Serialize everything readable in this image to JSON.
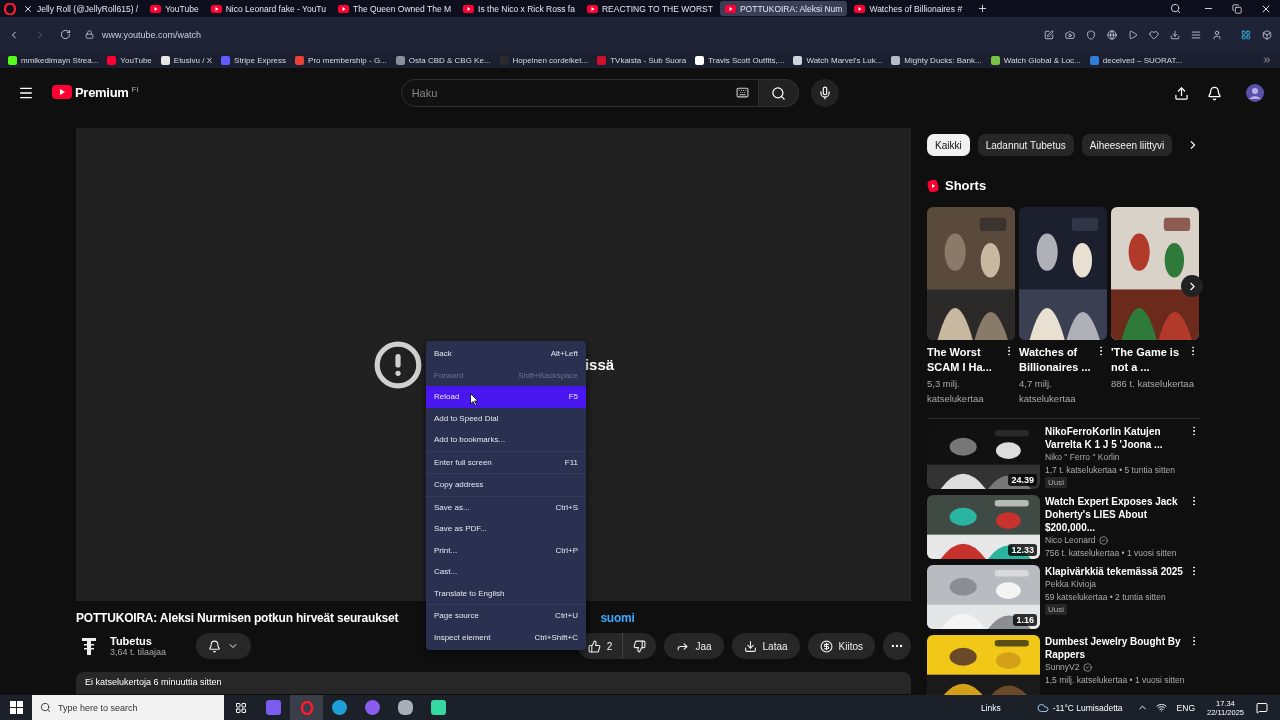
{
  "browser": {
    "tabs": [
      {
        "title": "Jelly Roll (@JellyRoll615) /",
        "kind": "x",
        "selected": false
      },
      {
        "title": "YouTube",
        "kind": "youtube",
        "selected": false
      },
      {
        "title": "Nico Leonard fake - YouTu",
        "kind": "youtube",
        "selected": false
      },
      {
        "title": "The Queen Owned The M",
        "kind": "youtube",
        "selected": false
      },
      {
        "title": "Is the Nico x Rick Ross fa",
        "kind": "youtube",
        "selected": false
      },
      {
        "title": "REACTING TO THE WORST",
        "kind": "youtube",
        "selected": false
      },
      {
        "title": "POTTUKOIRA: Aleksi Num",
        "kind": "youtube",
        "selected": true
      },
      {
        "title": "Watches of Billionaires #",
        "kind": "youtube",
        "selected": false
      }
    ],
    "address": "www.youtube.com/watch",
    "bookmarks": [
      {
        "label": "mmikedimayn Strea...",
        "color": "#53fc18"
      },
      {
        "label": "YouTube",
        "color": "#ff0033"
      },
      {
        "label": "Etusivu / X",
        "color": "#e6e6e6"
      },
      {
        "label": "Stripe Express",
        "color": "#635bff"
      },
      {
        "label": "Pro membership - G...",
        "color": "#ea4335"
      },
      {
        "label": "Osta CBD & CBG Ke...",
        "color": "#8a8f99"
      },
      {
        "label": "Hopeinen cordelket...",
        "color": "#2b2b2b"
      },
      {
        "label": "TVkaista - Sub Suora",
        "color": "#d0102a"
      },
      {
        "label": "Travis Scott Outfits,...",
        "color": "#ffffff"
      },
      {
        "label": "Watch Marvel's Luk...",
        "color": "#cfd3dc"
      },
      {
        "label": "Mighty Ducks: Bank...",
        "color": "#b8bcc6"
      },
      {
        "label": "Watch Global & Loc...",
        "color": "#7cc242"
      },
      {
        "label": "deceived – SUORAT...",
        "color": "#2f7fd6"
      }
    ]
  },
  "header": {
    "logo": "Premium",
    "region": "FI",
    "search": {
      "placeholder": "Haku"
    }
  },
  "player": {
    "error_text": "issä"
  },
  "video": {
    "title": "POTTUKOIRA: Aleksi Nurmisen potkun hirveät seuraukset",
    "hashtag": "suomi",
    "channel": "Tubetus",
    "subscribers": "3,64 t. tilaajaa",
    "likes": "2",
    "actions": [
      {
        "kind": "share",
        "label": "Jaa"
      },
      {
        "kind": "download",
        "label": "Lataa"
      },
      {
        "kind": "thanks",
        "label": "Kiitos"
      }
    ],
    "description": "Ei katselukertoja 6 minuuttia sitten"
  },
  "context_menu": {
    "groups": [
      [
        {
          "label": "Back",
          "shortcut": "Alt+Left",
          "disabled": false,
          "selected": false
        },
        {
          "label": "Forward",
          "shortcut": "Shift+Backspace",
          "disabled": true,
          "selected": false
        },
        {
          "label": "Reload",
          "shortcut": "F5",
          "disabled": false,
          "selected": true
        },
        {
          "label": "Add to Speed Dial",
          "disabled": false,
          "selected": false
        },
        {
          "label": "Add to bookmarks...",
          "disabled": false,
          "selected": false
        }
      ],
      [
        {
          "label": "Enter full screen",
          "shortcut": "F11",
          "disabled": false,
          "selected": false
        }
      ],
      [
        {
          "label": "Copy address",
          "disabled": false,
          "selected": false
        }
      ],
      [
        {
          "label": "Save as...",
          "shortcut": "Ctrl+S",
          "disabled": false,
          "selected": false
        },
        {
          "label": "Save as PDF...",
          "disabled": false,
          "selected": false
        },
        {
          "label": "Print...",
          "shortcut": "Ctrl+P",
          "disabled": false,
          "selected": false
        },
        {
          "label": "Cast...",
          "disabled": false,
          "selected": false
        },
        {
          "label": "Translate to English",
          "disabled": false,
          "selected": false
        }
      ],
      [
        {
          "label": "Page source",
          "shortcut": "Ctrl+U",
          "disabled": false,
          "selected": false
        },
        {
          "label": "Inspect element",
          "shortcut": "Ctrl+Shift+C",
          "disabled": false,
          "selected": false
        }
      ]
    ]
  },
  "sidebar": {
    "chips": [
      {
        "label": "Kaikki",
        "selected": true
      },
      {
        "label": "Ladannut Tubetus",
        "selected": false
      },
      {
        "label": "Aiheeseen liittyvi",
        "selected": false
      }
    ],
    "shorts_title": "Shorts",
    "shorts": [
      {
        "title": "The Worst SCAM I Ha...",
        "views": "5,3 milj. katselukertaa"
      },
      {
        "title": "Watches of Billionaires ...",
        "views": "4,7 milj. katselukertaa"
      },
      {
        "title": "'The Game is not a ...",
        "views": "886 t. katselukertaa"
      }
    ],
    "videos": [
      {
        "title": "NikoFerroKorlin Katujen Varrelta K 1   J 5 'Joona ...",
        "channel": "Niko \" Ferro \" Korlin",
        "verified": false,
        "meta": "1,7 t. katselukertaa • 5 tuntia sitten",
        "badge": "Uusi",
        "duration": "24.39"
      },
      {
        "title": "Watch Expert Exposes Jack Doherty's LIES About $200,000...",
        "channel": "Nico Leonard",
        "verified": true,
        "meta": "756 t. katselukertaa • 1 vuosi sitten",
        "duration": "12.33"
      },
      {
        "title": "Klapivärkkiä tekemässä 2025",
        "channel": "Pekka Kivioja",
        "verified": false,
        "meta": "59 katselukertaa • 2 tuntia sitten",
        "badge": "Uusi",
        "duration": "1.16"
      },
      {
        "title": "Dumbest Jewelry Bought By Rappers",
        "channel": "SunnyV2",
        "verified": true,
        "meta": "1,5 milj. katselukertaa • 1 vuosi sitten"
      }
    ]
  },
  "taskbar": {
    "search_placeholder": "Type here to search",
    "links": "Links",
    "weather": "-11°C Lumisadetta",
    "language": "ENG",
    "time": "17.34",
    "date": "22/11/2025"
  }
}
